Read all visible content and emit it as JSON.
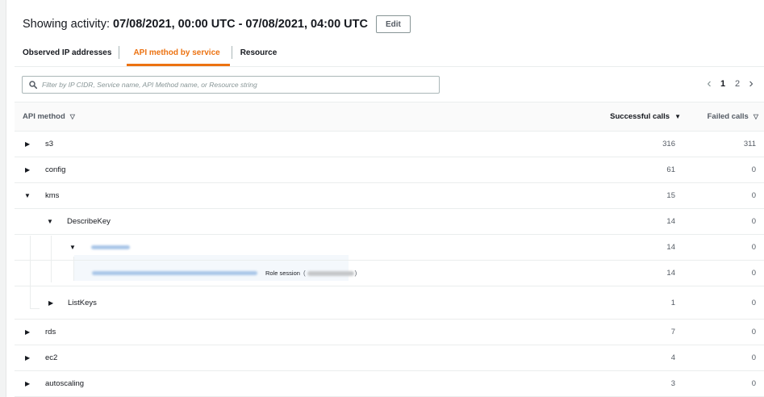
{
  "header": {
    "prefix": "Showing activity:",
    "range": "07/08/2021, 00:00 UTC - 07/08/2021, 04:00 UTC",
    "edit_label": "Edit"
  },
  "tabs": [
    {
      "label": "Observed IP addresses",
      "active": false
    },
    {
      "label": "API method by service",
      "active": true
    },
    {
      "label": "Resource",
      "active": false
    }
  ],
  "search": {
    "placeholder": "Filter by IP CIDR, Service name, API Method name, or Resource string",
    "icon": "search-icon"
  },
  "pagination": {
    "pages": [
      "1",
      "2"
    ],
    "current": "1",
    "prev_icon": "chevron-left-icon",
    "next_icon": "chevron-right-icon"
  },
  "table": {
    "columns": {
      "method": "API method",
      "successful": "Successful calls",
      "failed": "Failed calls"
    },
    "rows": [
      {
        "label": "s3",
        "expanded": false,
        "successful": "316",
        "failed": "311"
      },
      {
        "label": "config",
        "expanded": false,
        "successful": "61",
        "failed": "0"
      },
      {
        "label": "kms",
        "expanded": true,
        "successful": "15",
        "failed": "0"
      },
      {
        "label": "DescribeKey",
        "expanded": true,
        "successful": "14",
        "failed": "0"
      },
      {
        "label": "",
        "expanded": true,
        "successful": "14",
        "failed": "0"
      },
      {
        "label": "",
        "role_label": "Role session",
        "paren_open": "(",
        "paren_close": ")",
        "successful": "14",
        "failed": "0"
      },
      {
        "label": "ListKeys",
        "expanded": false,
        "successful": "1",
        "failed": "0"
      },
      {
        "label": "rds",
        "expanded": false,
        "successful": "7",
        "failed": "0"
      },
      {
        "label": "ec2",
        "expanded": false,
        "successful": "4",
        "failed": "0"
      },
      {
        "label": "autoscaling",
        "expanded": false,
        "successful": "3",
        "failed": "0"
      }
    ]
  },
  "colors": {
    "accent": "#ec7211",
    "text": "#16191f",
    "muted": "#545b64",
    "border": "#eaeded"
  }
}
